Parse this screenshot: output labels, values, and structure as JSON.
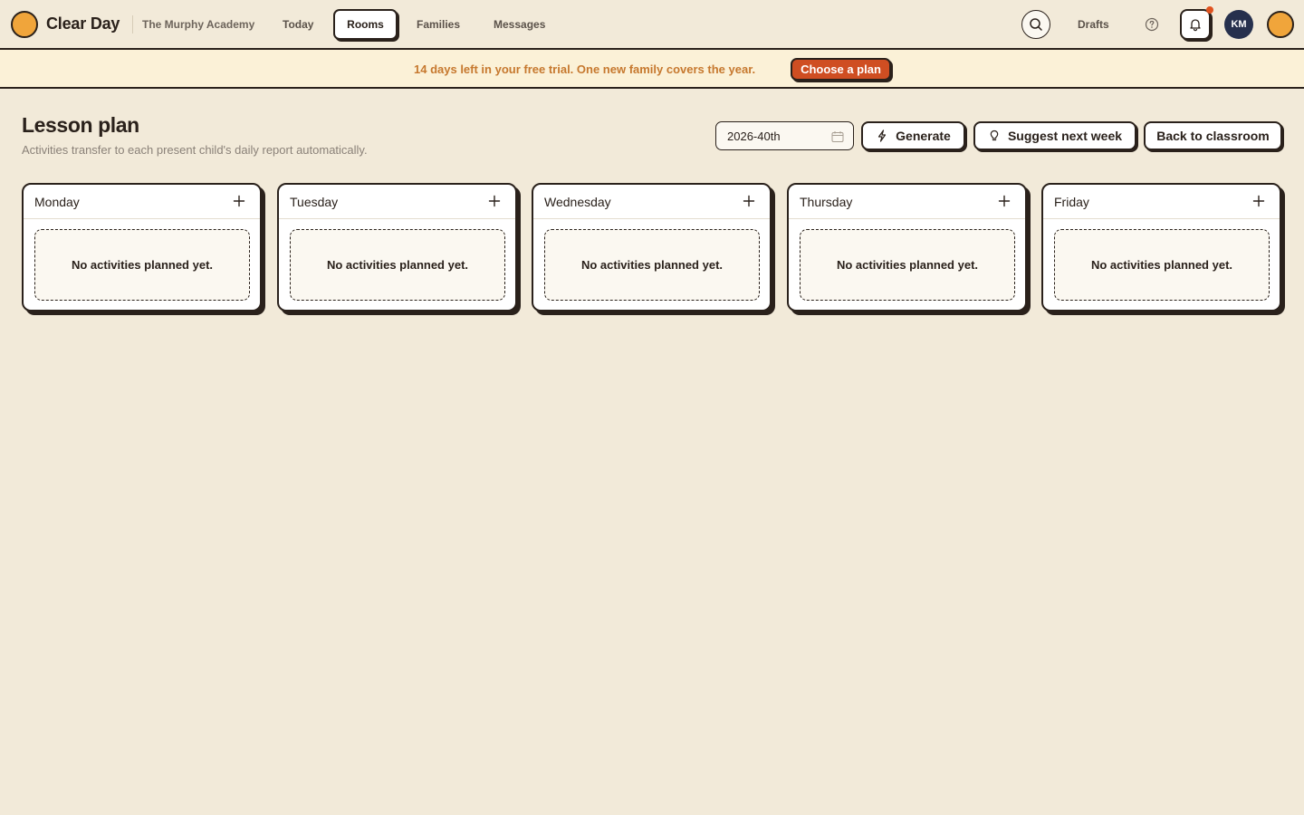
{
  "brand": {
    "name": "Clear Day"
  },
  "nav": {
    "academy": "The Murphy Academy",
    "today": "Today",
    "rooms": "Rooms",
    "families": "Families",
    "messages": "Messages",
    "drafts": "Drafts",
    "avatar_initials": "KM"
  },
  "banner": {
    "text": "14 days left in your free trial. One new family covers the year.",
    "cta": "Choose a plan"
  },
  "header": {
    "title": "Lesson plan",
    "subtitle": "Activities transfer to each present child's daily report automatically.",
    "week_value": "2026-40th",
    "generate_label": "Generate",
    "suggest_label": "Suggest next week",
    "back_label": "Back to classroom"
  },
  "days": [
    {
      "name": "Monday",
      "empty": "No activities planned yet."
    },
    {
      "name": "Tuesday",
      "empty": "No activities planned yet."
    },
    {
      "name": "Wednesday",
      "empty": "No activities planned yet."
    },
    {
      "name": "Thursday",
      "empty": "No activities planned yet."
    },
    {
      "name": "Friday",
      "empty": "No activities planned yet."
    }
  ],
  "colors": {
    "background": "#f2ead9",
    "accent": "#f0a53b",
    "cta": "#cf4e22",
    "ink": "#2a211b",
    "avatar": "#26304d"
  }
}
